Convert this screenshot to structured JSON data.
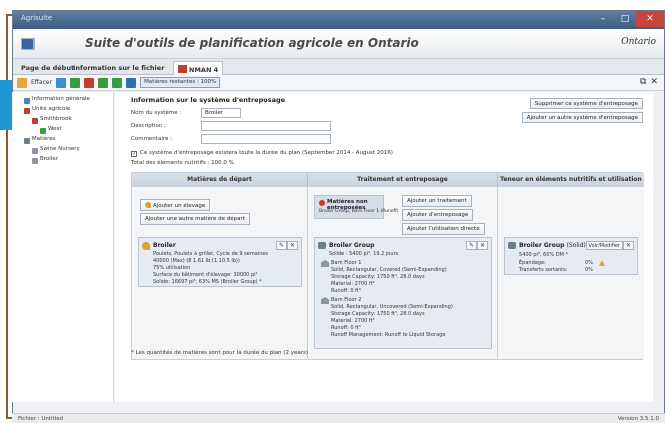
{
  "window": {
    "title": "Agrisuite",
    "controls": [
      "–",
      "□",
      "✕"
    ]
  },
  "banner": {
    "app_name": "Suite d'outils de planification agricole en Ontario",
    "logo_text": "Ontario"
  },
  "tabs": [
    {
      "label": "Page de début"
    },
    {
      "label": "Information sur le fichier"
    },
    {
      "label": "NMAN 4"
    }
  ],
  "toolbar": {
    "erase_label": "Effacer",
    "select_value": "Matières restantes : 100%",
    "close_glyph": "✕"
  },
  "tree": {
    "items": [
      {
        "label": "Information générale",
        "color": "#4a7fc1"
      },
      {
        "label": "Unité agricole",
        "color": "#c53b2e"
      },
      {
        "label": "Smithbrook",
        "color": "#c53b2e"
      },
      {
        "label": "West",
        "color": "#3a9a42"
      },
      {
        "label": "Matières",
        "color": "#6e7d8c"
      },
      {
        "label": "Swine Nursery",
        "color": "#8d96a0"
      },
      {
        "label": "Broiler",
        "color": "#8d96a0"
      }
    ]
  },
  "form": {
    "section_title": "Information sur le système d'entreposage",
    "system_name_label": "Nom du système :",
    "system_name_value": "Broiler",
    "description_label": "Description :",
    "comment_label": "Commentaire :",
    "delete_button": "Supprimer ce système d'entreposage",
    "add_button": "Ajouter un autre système d'entreposage",
    "checkbox_label": "Ce système d'entreposage existera toute la durée du plan (September 2014 - August 2016)",
    "total_label": "Total des éléments nutritifs : 100.0 %"
  },
  "flow": {
    "col1_header": "Matières de départ",
    "col2_header": "Traitement et entreposage",
    "col3_header": "Teneur en éléments nutritifs et utilisation",
    "add_animal_button": "Ajouter un élevage",
    "add_source_button": "Ajouter une autre matière de départ",
    "stored_material_title": "Matières non entreposées",
    "stored_material_sub": "Broiler Group, Barn Floor 1 (Runoff)",
    "add_treatment_button": "Ajouter un traitement",
    "add_storage_button": "Ajouter d'entreposage",
    "add_direct_use_button": "Ajouter l'utilisation directe",
    "broiler_card": {
      "title": "Broiler",
      "lines": [
        "Poulets, Poulets à griller, Cycle de 9 semaines",
        "40000 (Max) (8 1.61 lb (1.10.5 lb))",
        "75% utilisation",
        "Surface du bâtiment d'élevage: 30000 pi²",
        "Solide: 16697 pi³, 63% MS (Broiler Group) *"
      ]
    },
    "group_card": {
      "title": "Broiler Group",
      "lines": [
        "Solide : 5400 pi³, 19.2 jours",
        "Barn Floor 1",
        "Solid, Rectangular, Covered (Semi-Expanding)",
        "Storage Capacity: 1750 ft³, 28.0 days",
        "Material: 2700 ft³",
        "Runoff: 0 ft³",
        "Barn Floor 2",
        "Solid, Rectangular, Uncovered (Semi-Expanding)",
        "Storage Capacity: 1750 ft³, 28.0 days",
        "Material: 2700 ft³",
        "Runoff: 0 ft³",
        "Runoff Management: Runoff to Liquid Storage"
      ]
    },
    "result_card": {
      "title": "Broiler Group",
      "tag": "(Solid)",
      "modify_button": "Voir/Modifier",
      "lines": [
        "5400 pi³, 60% DM *",
        "Épandage:",
        "Transferts sortants:"
      ],
      "spread_value": "0%",
      "transfer_value": "0%"
    }
  },
  "footnote": "* Les quantités de matières sont pour la durée du plan (2 years)",
  "status": {
    "left": "Fichier : Untitled",
    "right": "Version 3.5.1.0"
  }
}
